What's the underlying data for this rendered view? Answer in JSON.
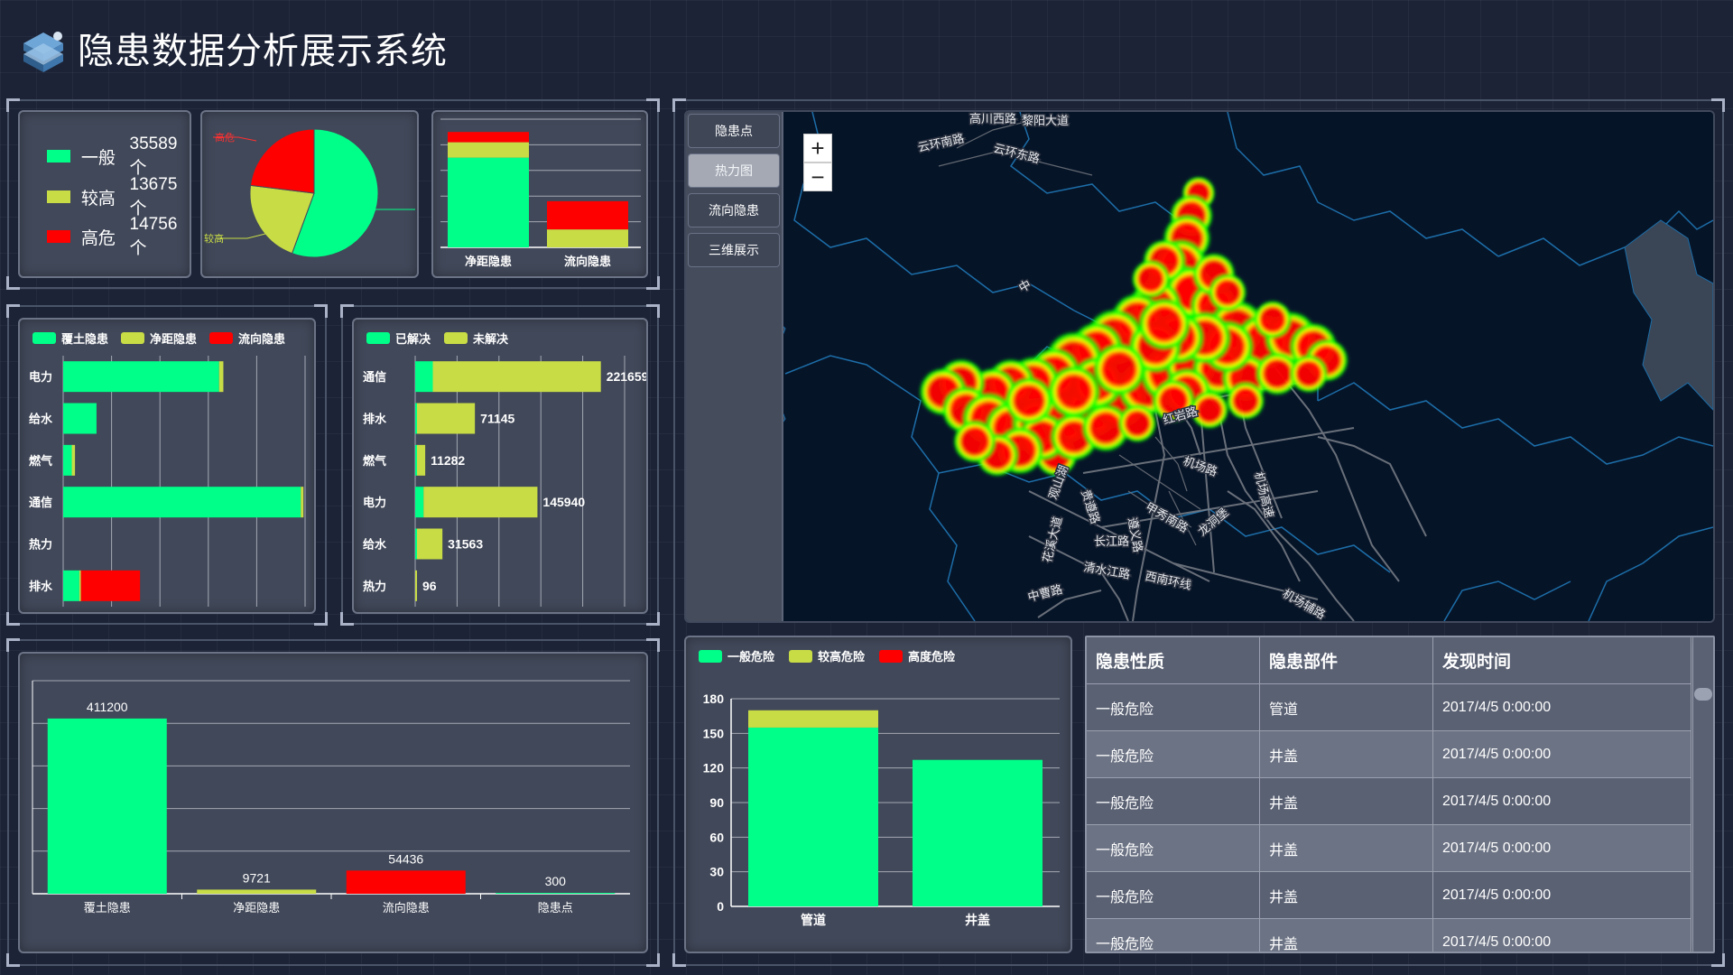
{
  "header": {
    "title": "隐患数据分析展示系统",
    "logo_icon": "server-stack-icon"
  },
  "summary": {
    "items": [
      {
        "name": "一般",
        "value": "35589个",
        "color": "#00ff88"
      },
      {
        "name": "较高",
        "value": "13675个",
        "color": "#c8dc46"
      },
      {
        "name": "高危",
        "value": "14756个",
        "color": "#ff0000"
      }
    ]
  },
  "pie": {
    "labels": {
      "high": "高危",
      "mid": "较高"
    }
  },
  "colors": {
    "green": "#00ff88",
    "yellow": "#c8dc46",
    "red": "#ff0000"
  },
  "chart_data": [
    {
      "id": "pie-level",
      "type": "pie",
      "labels": [
        "一般",
        "较高",
        "高危"
      ],
      "values": [
        35589,
        13675,
        14756
      ],
      "colors": [
        "#00ff88",
        "#c8dc46",
        "#ff0000"
      ]
    },
    {
      "id": "stacked-type",
      "type": "bar",
      "categories": [
        "净距隐患",
        "流向隐患"
      ],
      "series": [
        {
          "name": "一般",
          "values": [
            70,
            0
          ]
        },
        {
          "name": "较高",
          "values": [
            12,
            14
          ]
        },
        {
          "name": "高危",
          "values": [
            8,
            22
          ]
        }
      ],
      "ylim": [
        0,
        100
      ]
    },
    {
      "id": "hbar-category",
      "type": "bar",
      "orientation": "horizontal",
      "legend": [
        "覆土隐患",
        "净距隐患",
        "流向隐患"
      ],
      "categories": [
        "电力",
        "给水",
        "燃气",
        "通信",
        "热力",
        "排水"
      ],
      "series": [
        {
          "name": "覆土隐患",
          "values": [
            290,
            62,
            16,
            442,
            0,
            30
          ]
        },
        {
          "name": "净距隐患",
          "values": [
            8,
            0,
            6,
            5,
            0,
            3
          ]
        },
        {
          "name": "流向隐患",
          "values": [
            0,
            0,
            0,
            0,
            0,
            110
          ]
        }
      ],
      "xlim": [
        0,
        450
      ]
    },
    {
      "id": "hbar-resolved",
      "type": "bar",
      "orientation": "horizontal",
      "legend": [
        "已解决",
        "未解决"
      ],
      "categories": [
        "通信",
        "排水",
        "燃气",
        "电力",
        "给水",
        "热力"
      ],
      "series": [
        {
          "name": "已解决",
          "values": [
            21000,
            2000,
            1500,
            10000,
            1200,
            0
          ]
        },
        {
          "name": "未解决",
          "values": [
            200659,
            69145,
            9782,
            135940,
            30363,
            96
          ]
        }
      ],
      "data_labels": [
        "221659",
        "71145",
        "11282",
        "145940",
        "31563",
        "96"
      ],
      "xlim": [
        0,
        250000
      ]
    },
    {
      "id": "bar-totals",
      "type": "bar",
      "categories": [
        "覆土隐患",
        "净距隐患",
        "流向隐患",
        "隐患点"
      ],
      "values": [
        411200,
        9721,
        54436,
        300
      ],
      "colors": [
        "#00ff88",
        "#c8dc46",
        "#ff0000",
        "#00ff88"
      ],
      "data_labels": [
        "411200",
        "9721",
        "54436",
        "300"
      ],
      "ylim": [
        0,
        500000
      ]
    },
    {
      "id": "bar-risk",
      "type": "bar",
      "legend": [
        "一般危险",
        "较高危险",
        "高度危险"
      ],
      "categories": [
        "管道",
        "井盖"
      ],
      "series": [
        {
          "name": "一般危险",
          "values": [
            155,
            127
          ]
        },
        {
          "name": "较高危险",
          "values": [
            15,
            0
          ]
        },
        {
          "name": "高度危险",
          "values": [
            0,
            0
          ]
        }
      ],
      "yticks": [
        "0",
        "30",
        "60",
        "90",
        "120",
        "150",
        "180"
      ],
      "ylim": [
        0,
        180
      ]
    }
  ],
  "map": {
    "tabs": [
      "隐患点",
      "热力图",
      "流向隐患",
      "三维展示"
    ],
    "active_tab": "热力图",
    "zoom_in": "+",
    "zoom_out": "−",
    "road_labels": [
      "高川西路",
      "黎阳大道",
      "云环南路",
      "云环东路",
      "中",
      "红岩路",
      "机场路",
      "长江路",
      "清水江路",
      "西南环线",
      "中曹路",
      "花溪大道",
      "机场高速",
      "龙洞堡",
      "遵义路",
      "观山湖",
      "贵遵路",
      "甲秀南路",
      "机场辅路"
    ]
  },
  "table": {
    "headers": [
      "隐患性质",
      "隐患部件",
      "发现时间"
    ],
    "rows": [
      [
        "一般危险",
        "管道",
        "2017/4/5 0:00:00"
      ],
      [
        "一般危险",
        "井盖",
        "2017/4/5 0:00:00"
      ],
      [
        "一般危险",
        "井盖",
        "2017/4/5 0:00:00"
      ],
      [
        "一般危险",
        "井盖",
        "2017/4/5 0:00:00"
      ],
      [
        "一般危险",
        "井盖",
        "2017/4/5 0:00:00"
      ],
      [
        "一般危险",
        "井盖",
        "2017/4/5 0:00:00"
      ]
    ]
  }
}
